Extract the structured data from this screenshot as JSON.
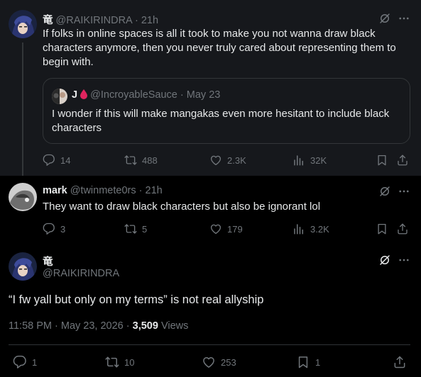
{
  "post1": {
    "display_name": "竜",
    "handle": "@RAIKIRINDRA",
    "separator": "·",
    "time": "21h",
    "text": "If folks in online spaces is all it took to make you not wanna draw black characters anymore, then you never truly cared about representing them to begin with.",
    "quote": {
      "display_name": "J",
      "handle": "@IncroyableSauce",
      "separator": "·",
      "time": "May 23",
      "text": "I wonder if this will make mangakas even more hesitant to include black characters"
    },
    "replies": "14",
    "reposts": "488",
    "likes": "2.3K",
    "views": "32K"
  },
  "post2": {
    "display_name": "mark",
    "handle": "@twinmete0rs",
    "separator": "·",
    "time": "21h",
    "text": "They want to draw black characters but also be ignorant lol",
    "replies": "3",
    "reposts": "5",
    "likes": "179",
    "views": "3.2K"
  },
  "post3": {
    "display_name": "竜",
    "handle": "@RAIKIRINDRA",
    "text": "“I fw yall but only on my terms” is not real allyship",
    "timestamp": "11:58 PM · May 23, 2026 · ",
    "view_count": "3,509",
    "views_label": " Views",
    "replies": "1",
    "reposts": "10",
    "likes": "253",
    "bookmarks": "1"
  },
  "colors": {
    "text": "#e7e9ea",
    "muted": "#71767b",
    "border": "#2f3336",
    "highlight_bg": "#16181c",
    "quote_emoji": "#e0245e"
  },
  "icons": [
    "grok-icon",
    "more-icon",
    "reply-icon",
    "repost-icon",
    "like-icon",
    "views-icon",
    "bookmark-icon",
    "share-icon",
    "drop-emoji-icon"
  ]
}
